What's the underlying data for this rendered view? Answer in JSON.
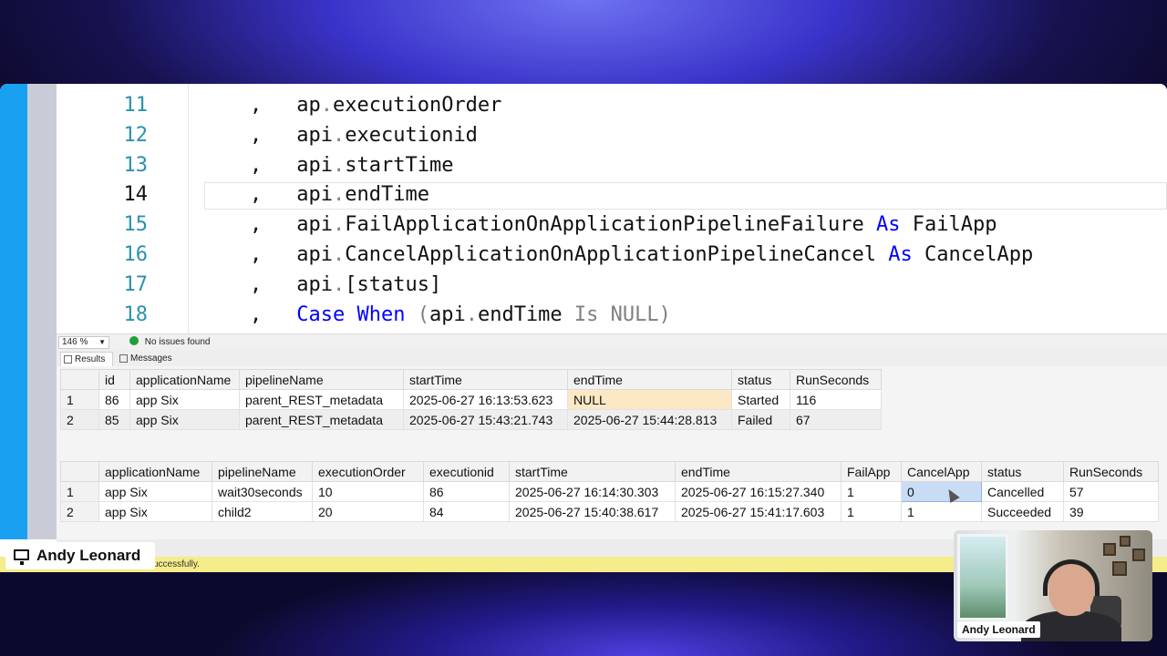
{
  "editor": {
    "lines": [
      {
        "num": "11",
        "segments": [
          {
            "t": ", ",
            "c": ""
          },
          {
            "t": "ap",
            "c": ""
          },
          {
            "t": ".",
            "c": "gr"
          },
          {
            "t": "executionOrder",
            "c": ""
          }
        ]
      },
      {
        "num": "12",
        "segments": [
          {
            "t": ", ",
            "c": ""
          },
          {
            "t": "api",
            "c": ""
          },
          {
            "t": ".",
            "c": "gr"
          },
          {
            "t": "executionid",
            "c": ""
          }
        ]
      },
      {
        "num": "13",
        "segments": [
          {
            "t": ", ",
            "c": ""
          },
          {
            "t": "api",
            "c": ""
          },
          {
            "t": ".",
            "c": "gr"
          },
          {
            "t": "startTime",
            "c": ""
          }
        ]
      },
      {
        "num": "14",
        "active": true,
        "segments": [
          {
            "t": ", ",
            "c": ""
          },
          {
            "t": "api",
            "c": ""
          },
          {
            "t": ".",
            "c": "gr"
          },
          {
            "t": "endTime",
            "c": ""
          }
        ]
      },
      {
        "num": "15",
        "segments": [
          {
            "t": ", ",
            "c": ""
          },
          {
            "t": "api",
            "c": ""
          },
          {
            "t": ".",
            "c": "gr"
          },
          {
            "t": "FailApplicationOnApplicationPipelineFailure ",
            "c": ""
          },
          {
            "t": "As",
            "c": "kw"
          },
          {
            "t": " FailApp",
            "c": ""
          }
        ]
      },
      {
        "num": "16",
        "segments": [
          {
            "t": ", ",
            "c": ""
          },
          {
            "t": "api",
            "c": ""
          },
          {
            "t": ".",
            "c": "gr"
          },
          {
            "t": "CancelApplicationOnApplicationPipelineCancel ",
            "c": ""
          },
          {
            "t": "As",
            "c": "kw"
          },
          {
            "t": " CancelApp",
            "c": ""
          }
        ]
      },
      {
        "num": "17",
        "segments": [
          {
            "t": ", ",
            "c": ""
          },
          {
            "t": "api",
            "c": ""
          },
          {
            "t": ".",
            "c": "gr"
          },
          {
            "t": "[status]",
            "c": ""
          }
        ]
      },
      {
        "num": "18",
        "segments": [
          {
            "t": ", ",
            "c": ""
          },
          {
            "t": "Case",
            "c": "kw"
          },
          {
            "t": " ",
            "c": ""
          },
          {
            "t": "When",
            "c": "kw"
          },
          {
            "t": " ",
            "c": ""
          },
          {
            "t": "(",
            "c": "gr"
          },
          {
            "t": "api",
            "c": ""
          },
          {
            "t": ".",
            "c": "gr"
          },
          {
            "t": "endTime ",
            "c": ""
          },
          {
            "t": "Is NULL",
            "c": "gr"
          },
          {
            "t": ")",
            "c": "gr"
          }
        ]
      }
    ]
  },
  "editor_status": {
    "zoom": "146 %",
    "issues": "No issues found"
  },
  "tabs": {
    "results": "Results",
    "messages": "Messages"
  },
  "grid1": {
    "columns": [
      "",
      "id",
      "applicationName",
      "pipelineName",
      "startTime",
      "endTime",
      "status",
      "RunSeconds"
    ],
    "rows": [
      [
        "1",
        "86",
        "app Six",
        "parent_REST_metadata",
        "2025-06-27 16:13:53.623",
        "NULL",
        "Started",
        "116"
      ],
      [
        "2",
        "85",
        "app Six",
        "parent_REST_metadata",
        "2025-06-27 15:43:21.743",
        "2025-06-27 15:44:28.813",
        "Failed",
        "67"
      ]
    ]
  },
  "grid2": {
    "columns": [
      "",
      "applicationName",
      "pipelineName",
      "executionOrder",
      "executionid",
      "startTime",
      "endTime",
      "FailApp",
      "CancelApp",
      "status",
      "RunSeconds"
    ],
    "rows": [
      [
        "1",
        "app Six",
        "wait30seconds",
        "10",
        "86",
        "2025-06-27 16:14:30.303",
        "2025-06-27 16:15:27.340",
        "1",
        "0",
        "Cancelled",
        "57"
      ],
      [
        "2",
        "app Six",
        "child2",
        "20",
        "84",
        "2025-06-27 15:40:38.617",
        "2025-06-27 15:41:17.603",
        "1",
        "1",
        "Succeeded",
        "39"
      ]
    ]
  },
  "statusbar": {
    "text": "uccessfully."
  },
  "presenter": {
    "name": "Andy Leonard",
    "cam_label": "Andy Leonard"
  }
}
